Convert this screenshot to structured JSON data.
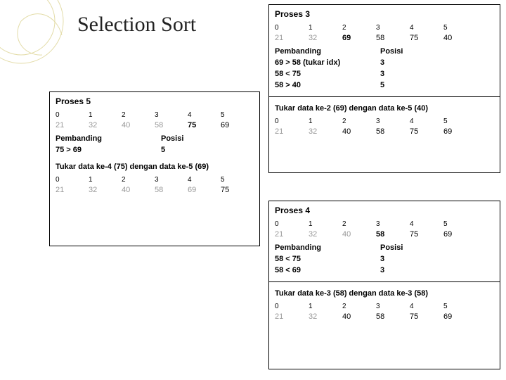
{
  "page_title": "Selection Sort",
  "labels": {
    "pembanding": "Pembanding",
    "posisi": "Posisi"
  },
  "p5": {
    "title": "Proses 5",
    "before": [
      {
        "idx": "0",
        "val": "21",
        "sorted": true
      },
      {
        "idx": "1",
        "val": "32",
        "sorted": true
      },
      {
        "idx": "2",
        "val": "40",
        "sorted": true
      },
      {
        "idx": "3",
        "val": "58",
        "sorted": true
      },
      {
        "idx": "4",
        "val": "75",
        "active": true
      },
      {
        "idx": "5",
        "val": "69"
      }
    ],
    "cmp": [
      {
        "text": "75 > 69",
        "pos": "5"
      }
    ],
    "swap": "Tukar data ke-4 (75) dengan data ke-5 (69)",
    "after": [
      {
        "idx": "0",
        "val": "21",
        "sorted": true
      },
      {
        "idx": "1",
        "val": "32",
        "sorted": true
      },
      {
        "idx": "2",
        "val": "40",
        "sorted": true
      },
      {
        "idx": "3",
        "val": "58",
        "sorted": true
      },
      {
        "idx": "4",
        "val": "69",
        "sorted": true
      },
      {
        "idx": "5",
        "val": "75"
      }
    ]
  },
  "p3": {
    "title": "Proses 3",
    "before": [
      {
        "idx": "0",
        "val": "21",
        "sorted": true
      },
      {
        "idx": "1",
        "val": "32",
        "sorted": true
      },
      {
        "idx": "2",
        "val": "69",
        "active": true
      },
      {
        "idx": "3",
        "val": "58"
      },
      {
        "idx": "4",
        "val": "75"
      },
      {
        "idx": "5",
        "val": "40"
      }
    ],
    "cmp": [
      {
        "text": "69 > 58 (tukar idx)",
        "pos": "3"
      },
      {
        "text": "58 < 75",
        "pos": "3"
      },
      {
        "text": "58 > 40",
        "pos": "5"
      }
    ],
    "swap": "Tukar data ke-2 (69) dengan data ke-5 (40)",
    "after": [
      {
        "idx": "0",
        "val": "21",
        "sorted": true
      },
      {
        "idx": "1",
        "val": "32",
        "sorted": true
      },
      {
        "idx": "2",
        "val": "40"
      },
      {
        "idx": "3",
        "val": "58"
      },
      {
        "idx": "4",
        "val": "75"
      },
      {
        "idx": "5",
        "val": "69"
      }
    ]
  },
  "p4": {
    "title": "Proses 4",
    "before": [
      {
        "idx": "0",
        "val": "21",
        "sorted": true
      },
      {
        "idx": "1",
        "val": "32",
        "sorted": true
      },
      {
        "idx": "2",
        "val": "40",
        "sorted": true
      },
      {
        "idx": "3",
        "val": "58",
        "active": true
      },
      {
        "idx": "4",
        "val": "75"
      },
      {
        "idx": "5",
        "val": "69"
      }
    ],
    "cmp": [
      {
        "text": "58 < 75",
        "pos": "3"
      },
      {
        "text": "58 < 69",
        "pos": "3"
      }
    ],
    "swap": "Tukar data ke-3 (58) dengan data ke-3 (58)",
    "after": [
      {
        "idx": "0",
        "val": "21",
        "sorted": true
      },
      {
        "idx": "1",
        "val": "32",
        "sorted": true
      },
      {
        "idx": "2",
        "val": "40"
      },
      {
        "idx": "3",
        "val": "58"
      },
      {
        "idx": "4",
        "val": "75"
      },
      {
        "idx": "5",
        "val": "69"
      }
    ]
  }
}
